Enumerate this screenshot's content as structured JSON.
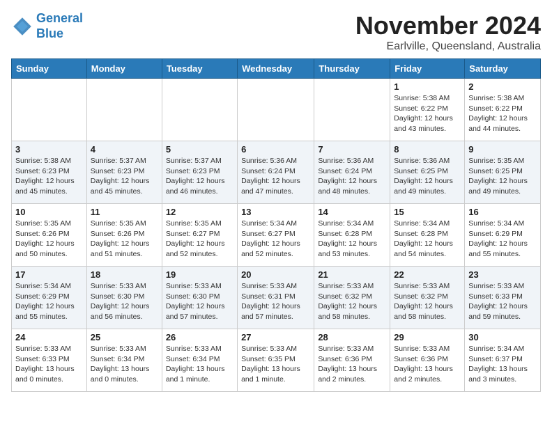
{
  "logo": {
    "line1": "General",
    "line2": "Blue"
  },
  "title": {
    "month_year": "November 2024",
    "location": "Earlville, Queensland, Australia"
  },
  "days_of_week": [
    "Sunday",
    "Monday",
    "Tuesday",
    "Wednesday",
    "Thursday",
    "Friday",
    "Saturday"
  ],
  "weeks": [
    {
      "days": [
        {
          "number": "",
          "info": ""
        },
        {
          "number": "",
          "info": ""
        },
        {
          "number": "",
          "info": ""
        },
        {
          "number": "",
          "info": ""
        },
        {
          "number": "",
          "info": ""
        },
        {
          "number": "1",
          "info": "Sunrise: 5:38 AM\nSunset: 6:22 PM\nDaylight: 12 hours\nand 43 minutes."
        },
        {
          "number": "2",
          "info": "Sunrise: 5:38 AM\nSunset: 6:22 PM\nDaylight: 12 hours\nand 44 minutes."
        }
      ]
    },
    {
      "days": [
        {
          "number": "3",
          "info": "Sunrise: 5:38 AM\nSunset: 6:23 PM\nDaylight: 12 hours\nand 45 minutes."
        },
        {
          "number": "4",
          "info": "Sunrise: 5:37 AM\nSunset: 6:23 PM\nDaylight: 12 hours\nand 45 minutes."
        },
        {
          "number": "5",
          "info": "Sunrise: 5:37 AM\nSunset: 6:23 PM\nDaylight: 12 hours\nand 46 minutes."
        },
        {
          "number": "6",
          "info": "Sunrise: 5:36 AM\nSunset: 6:24 PM\nDaylight: 12 hours\nand 47 minutes."
        },
        {
          "number": "7",
          "info": "Sunrise: 5:36 AM\nSunset: 6:24 PM\nDaylight: 12 hours\nand 48 minutes."
        },
        {
          "number": "8",
          "info": "Sunrise: 5:36 AM\nSunset: 6:25 PM\nDaylight: 12 hours\nand 49 minutes."
        },
        {
          "number": "9",
          "info": "Sunrise: 5:35 AM\nSunset: 6:25 PM\nDaylight: 12 hours\nand 49 minutes."
        }
      ]
    },
    {
      "days": [
        {
          "number": "10",
          "info": "Sunrise: 5:35 AM\nSunset: 6:26 PM\nDaylight: 12 hours\nand 50 minutes."
        },
        {
          "number": "11",
          "info": "Sunrise: 5:35 AM\nSunset: 6:26 PM\nDaylight: 12 hours\nand 51 minutes."
        },
        {
          "number": "12",
          "info": "Sunrise: 5:35 AM\nSunset: 6:27 PM\nDaylight: 12 hours\nand 52 minutes."
        },
        {
          "number": "13",
          "info": "Sunrise: 5:34 AM\nSunset: 6:27 PM\nDaylight: 12 hours\nand 52 minutes."
        },
        {
          "number": "14",
          "info": "Sunrise: 5:34 AM\nSunset: 6:28 PM\nDaylight: 12 hours\nand 53 minutes."
        },
        {
          "number": "15",
          "info": "Sunrise: 5:34 AM\nSunset: 6:28 PM\nDaylight: 12 hours\nand 54 minutes."
        },
        {
          "number": "16",
          "info": "Sunrise: 5:34 AM\nSunset: 6:29 PM\nDaylight: 12 hours\nand 55 minutes."
        }
      ]
    },
    {
      "days": [
        {
          "number": "17",
          "info": "Sunrise: 5:34 AM\nSunset: 6:29 PM\nDaylight: 12 hours\nand 55 minutes."
        },
        {
          "number": "18",
          "info": "Sunrise: 5:33 AM\nSunset: 6:30 PM\nDaylight: 12 hours\nand 56 minutes."
        },
        {
          "number": "19",
          "info": "Sunrise: 5:33 AM\nSunset: 6:30 PM\nDaylight: 12 hours\nand 57 minutes."
        },
        {
          "number": "20",
          "info": "Sunrise: 5:33 AM\nSunset: 6:31 PM\nDaylight: 12 hours\nand 57 minutes."
        },
        {
          "number": "21",
          "info": "Sunrise: 5:33 AM\nSunset: 6:32 PM\nDaylight: 12 hours\nand 58 minutes."
        },
        {
          "number": "22",
          "info": "Sunrise: 5:33 AM\nSunset: 6:32 PM\nDaylight: 12 hours\nand 58 minutes."
        },
        {
          "number": "23",
          "info": "Sunrise: 5:33 AM\nSunset: 6:33 PM\nDaylight: 12 hours\nand 59 minutes."
        }
      ]
    },
    {
      "days": [
        {
          "number": "24",
          "info": "Sunrise: 5:33 AM\nSunset: 6:33 PM\nDaylight: 13 hours\nand 0 minutes."
        },
        {
          "number": "25",
          "info": "Sunrise: 5:33 AM\nSunset: 6:34 PM\nDaylight: 13 hours\nand 0 minutes."
        },
        {
          "number": "26",
          "info": "Sunrise: 5:33 AM\nSunset: 6:34 PM\nDaylight: 13 hours\nand 1 minute."
        },
        {
          "number": "27",
          "info": "Sunrise: 5:33 AM\nSunset: 6:35 PM\nDaylight: 13 hours\nand 1 minute."
        },
        {
          "number": "28",
          "info": "Sunrise: 5:33 AM\nSunset: 6:36 PM\nDaylight: 13 hours\nand 2 minutes."
        },
        {
          "number": "29",
          "info": "Sunrise: 5:33 AM\nSunset: 6:36 PM\nDaylight: 13 hours\nand 2 minutes."
        },
        {
          "number": "30",
          "info": "Sunrise: 5:34 AM\nSunset: 6:37 PM\nDaylight: 13 hours\nand 3 minutes."
        }
      ]
    }
  ]
}
